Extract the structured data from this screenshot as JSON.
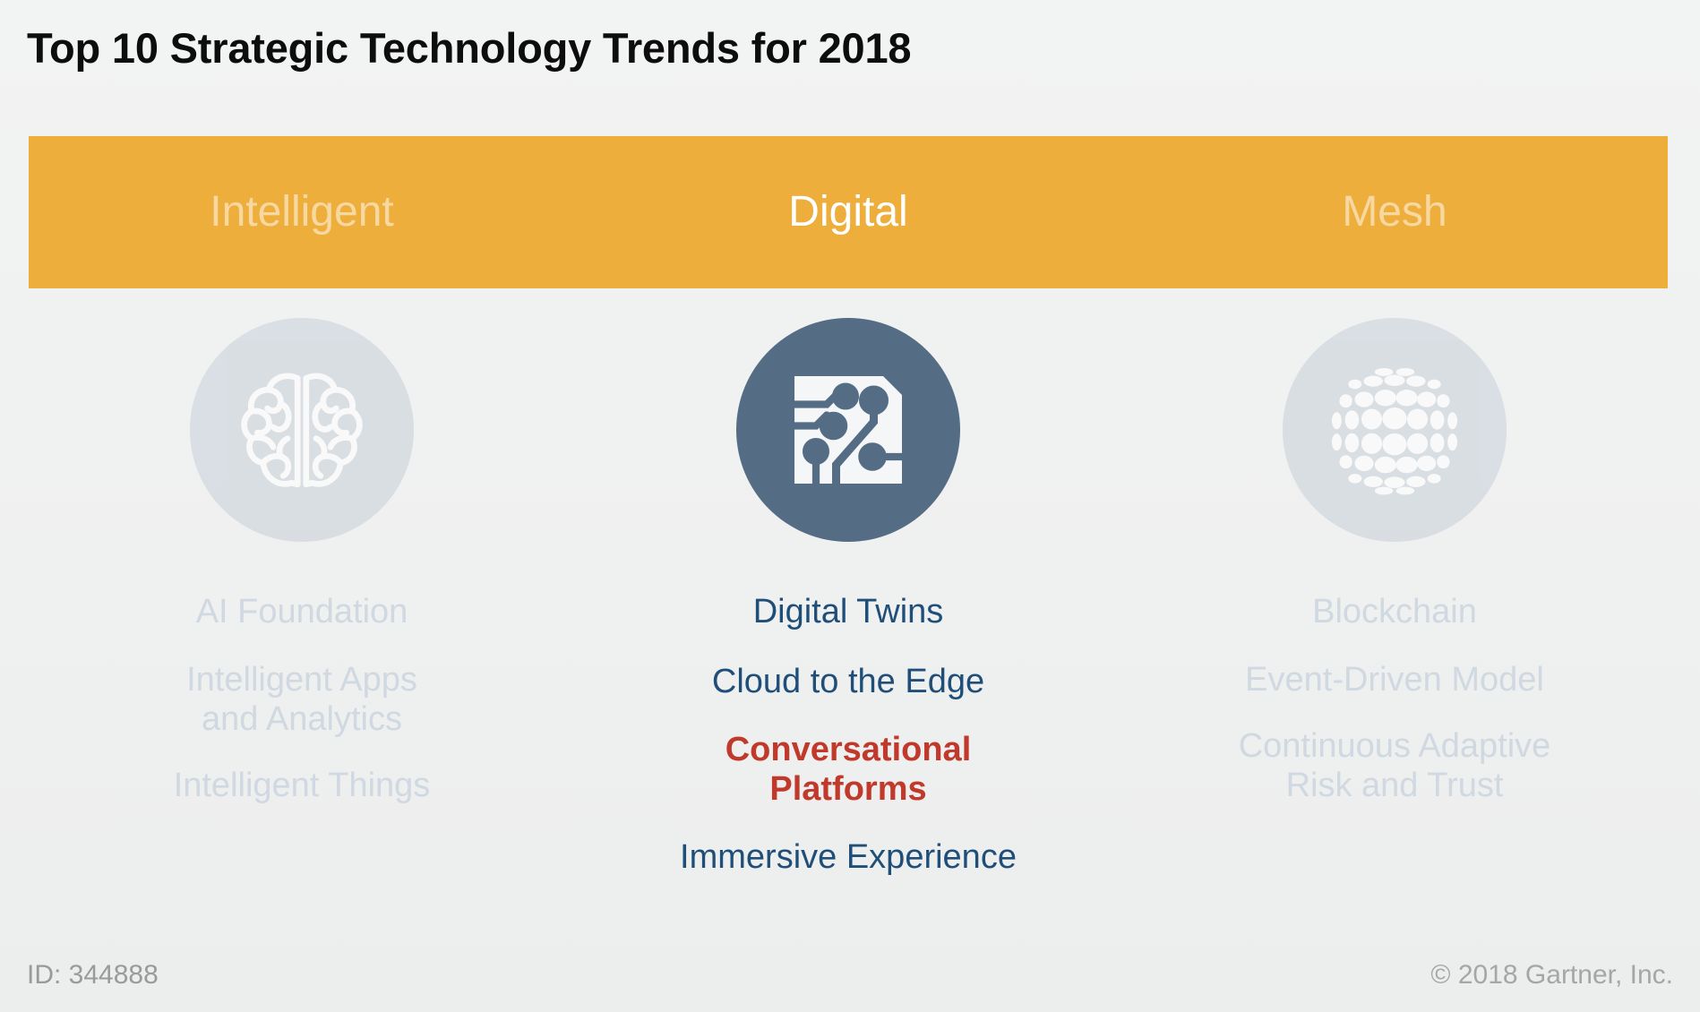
{
  "page": {
    "title": "Top 10 Strategic Technology Trends for 2018",
    "background_color": "#f0f1f1"
  },
  "category_bar": {
    "background_color": "#eeae3c",
    "active_text_color": "#ffffff",
    "dim_text_color": "rgba(255,255,255,0.52)",
    "categories": [
      {
        "label": "Intelligent",
        "state": "dim"
      },
      {
        "label": "Digital",
        "state": "active"
      },
      {
        "label": "Mesh",
        "state": "dim"
      }
    ]
  },
  "columns": [
    {
      "key": "intelligent",
      "icon": "brain-icon",
      "icon_state": "dim",
      "icon_circle_color": "#ccd3db",
      "trends": [
        {
          "label": "AI Foundation",
          "style": "dim"
        },
        {
          "label": "Intelligent Apps\nand Analytics",
          "style": "dim"
        },
        {
          "label": "Intelligent Things",
          "style": "dim"
        }
      ]
    },
    {
      "key": "digital",
      "icon": "circuit-chip-icon",
      "icon_state": "active",
      "icon_circle_color": "#546d85",
      "trends": [
        {
          "label": "Digital Twins",
          "style": "navy"
        },
        {
          "label": "Cloud to the Edge",
          "style": "navy"
        },
        {
          "label": "Conversational\nPlatforms",
          "style": "red"
        },
        {
          "label": "Immersive Experience",
          "style": "navy"
        }
      ]
    },
    {
      "key": "mesh",
      "icon": "globe-mesh-icon",
      "icon_state": "dim",
      "icon_circle_color": "#ccd3db",
      "trends": [
        {
          "label": "Blockchain",
          "style": "dim"
        },
        {
          "label": "Event-Driven Model",
          "style": "dim"
        },
        {
          "label": "Continuous Adaptive\nRisk and Trust",
          "style": "dim"
        }
      ]
    }
  ],
  "footer": {
    "id_text": "ID: 344888",
    "copyright": "© 2018 Gartner, Inc."
  },
  "colors": {
    "orange": "#eeae3c",
    "navy": "#1f4e79",
    "red": "#c0392b",
    "dim_text": "#d0d8e1",
    "slate": "#546d85",
    "footer_text": "#9a9a9a"
  }
}
